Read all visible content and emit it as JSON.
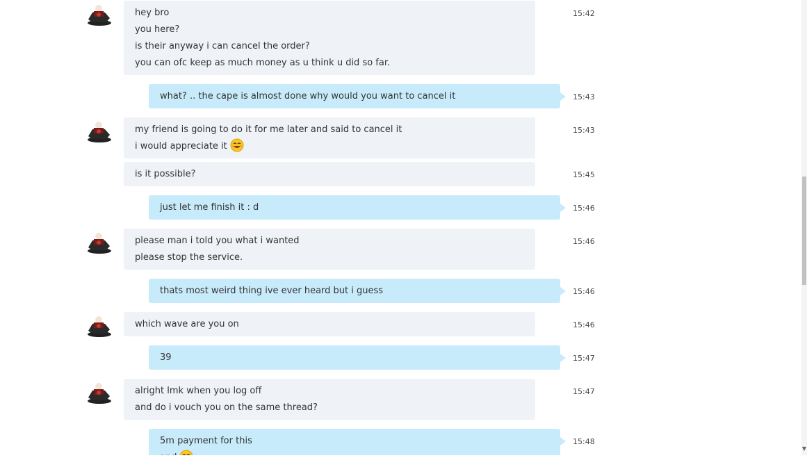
{
  "conversation": {
    "groups": [
      {
        "sender": "contact",
        "time": "15:42",
        "lines": [
          "hey bro",
          "you here?",
          "is their anyway i can cancel the order?",
          "you can ofc keep as much money as u think u did so far."
        ]
      },
      {
        "sender": "me",
        "time": "15:43",
        "lines": [
          "what? .. the cape is almost done why would you want to cancel it"
        ]
      },
      {
        "sender": "contact",
        "time": "15:43",
        "lines": [
          "my friend is going to do it for me later and said to cancel it",
          "i would appreciate it"
        ],
        "emoji_after_line": 1
      },
      {
        "sender": "contact",
        "time": "15:45",
        "lines": [
          "is it possible?"
        ]
      },
      {
        "sender": "me",
        "time": "15:46",
        "lines": [
          "just let me finish it : d"
        ]
      },
      {
        "sender": "contact",
        "time": "15:46",
        "lines": [
          "please man i told you what i wanted",
          "please stop the service."
        ]
      },
      {
        "sender": "me",
        "time": "15:46",
        "lines": [
          "thats most weird thing ive ever heard but i guess"
        ]
      },
      {
        "sender": "contact",
        "time": "15:46",
        "lines": [
          "which wave are you on"
        ]
      },
      {
        "sender": "me",
        "time": "15:47",
        "lines": [
          "39"
        ]
      },
      {
        "sender": "contact",
        "time": "15:47",
        "lines": [
          "alright lmk when you log off",
          "and do i vouch you on the same thread?"
        ]
      },
      {
        "sender": "me",
        "time": "15:48",
        "lines": [
          "5m payment for this",
          "and"
        ],
        "emoji_after_line": 1
      }
    ]
  },
  "icons": {
    "avatar": "contact-avatar",
    "emoji": "smiling-emoji-icon"
  },
  "colors": {
    "incoming_bubble": "#eff2f7",
    "outgoing_bubble": "#c8ebfb",
    "text": "#333333",
    "timestamp": "#444444"
  }
}
